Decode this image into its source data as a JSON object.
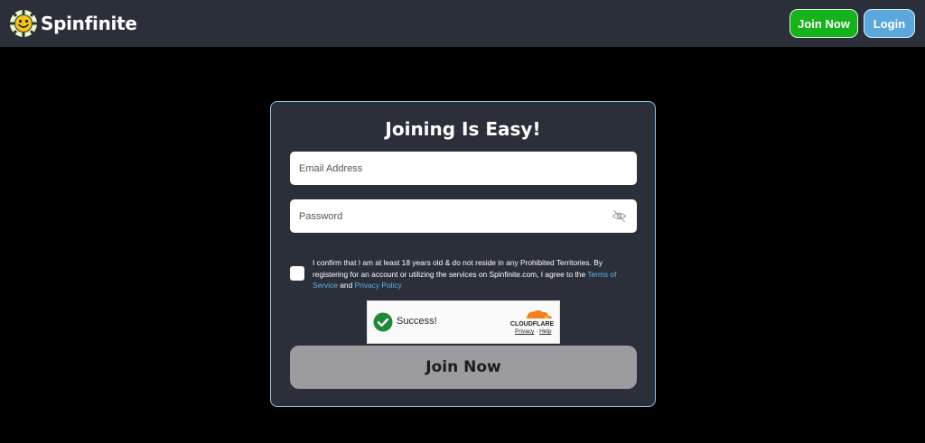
{
  "header": {
    "brand": "Spinfinite",
    "join_label": "Join Now",
    "login_label": "Login"
  },
  "form": {
    "title": "Joining Is Easy!",
    "email_placeholder": "Email Address",
    "password_placeholder": "Password",
    "consent_prefix": "I confirm that I am at least 18 years old & do not reside in any Prohibited Territories. By registering for an account or utilizing the services on Spinfinite.com, I agree to the ",
    "terms_label": "Terms of Service",
    "consent_and": " and ",
    "privacy_label": "Privacy Policy",
    "submit_label": "Join Now"
  },
  "captcha": {
    "status": "Success!",
    "brand": "CLOUDFLARE",
    "privacy_label": "Privacy",
    "separator": "·",
    "help_label": "Help"
  },
  "colors": {
    "background": "#000000",
    "header_bg": "#2b2f3a",
    "join_button": "#16b21c",
    "login_button": "#5aa7dc",
    "submit_button": "#9c9ca0",
    "link": "#5fb4e6",
    "cloudflare_orange": "#f48120"
  },
  "icons": {
    "logo": "poker-chip-smiley-icon",
    "password_toggle": "eye-slash-icon",
    "captcha_status": "check-circle-icon"
  }
}
